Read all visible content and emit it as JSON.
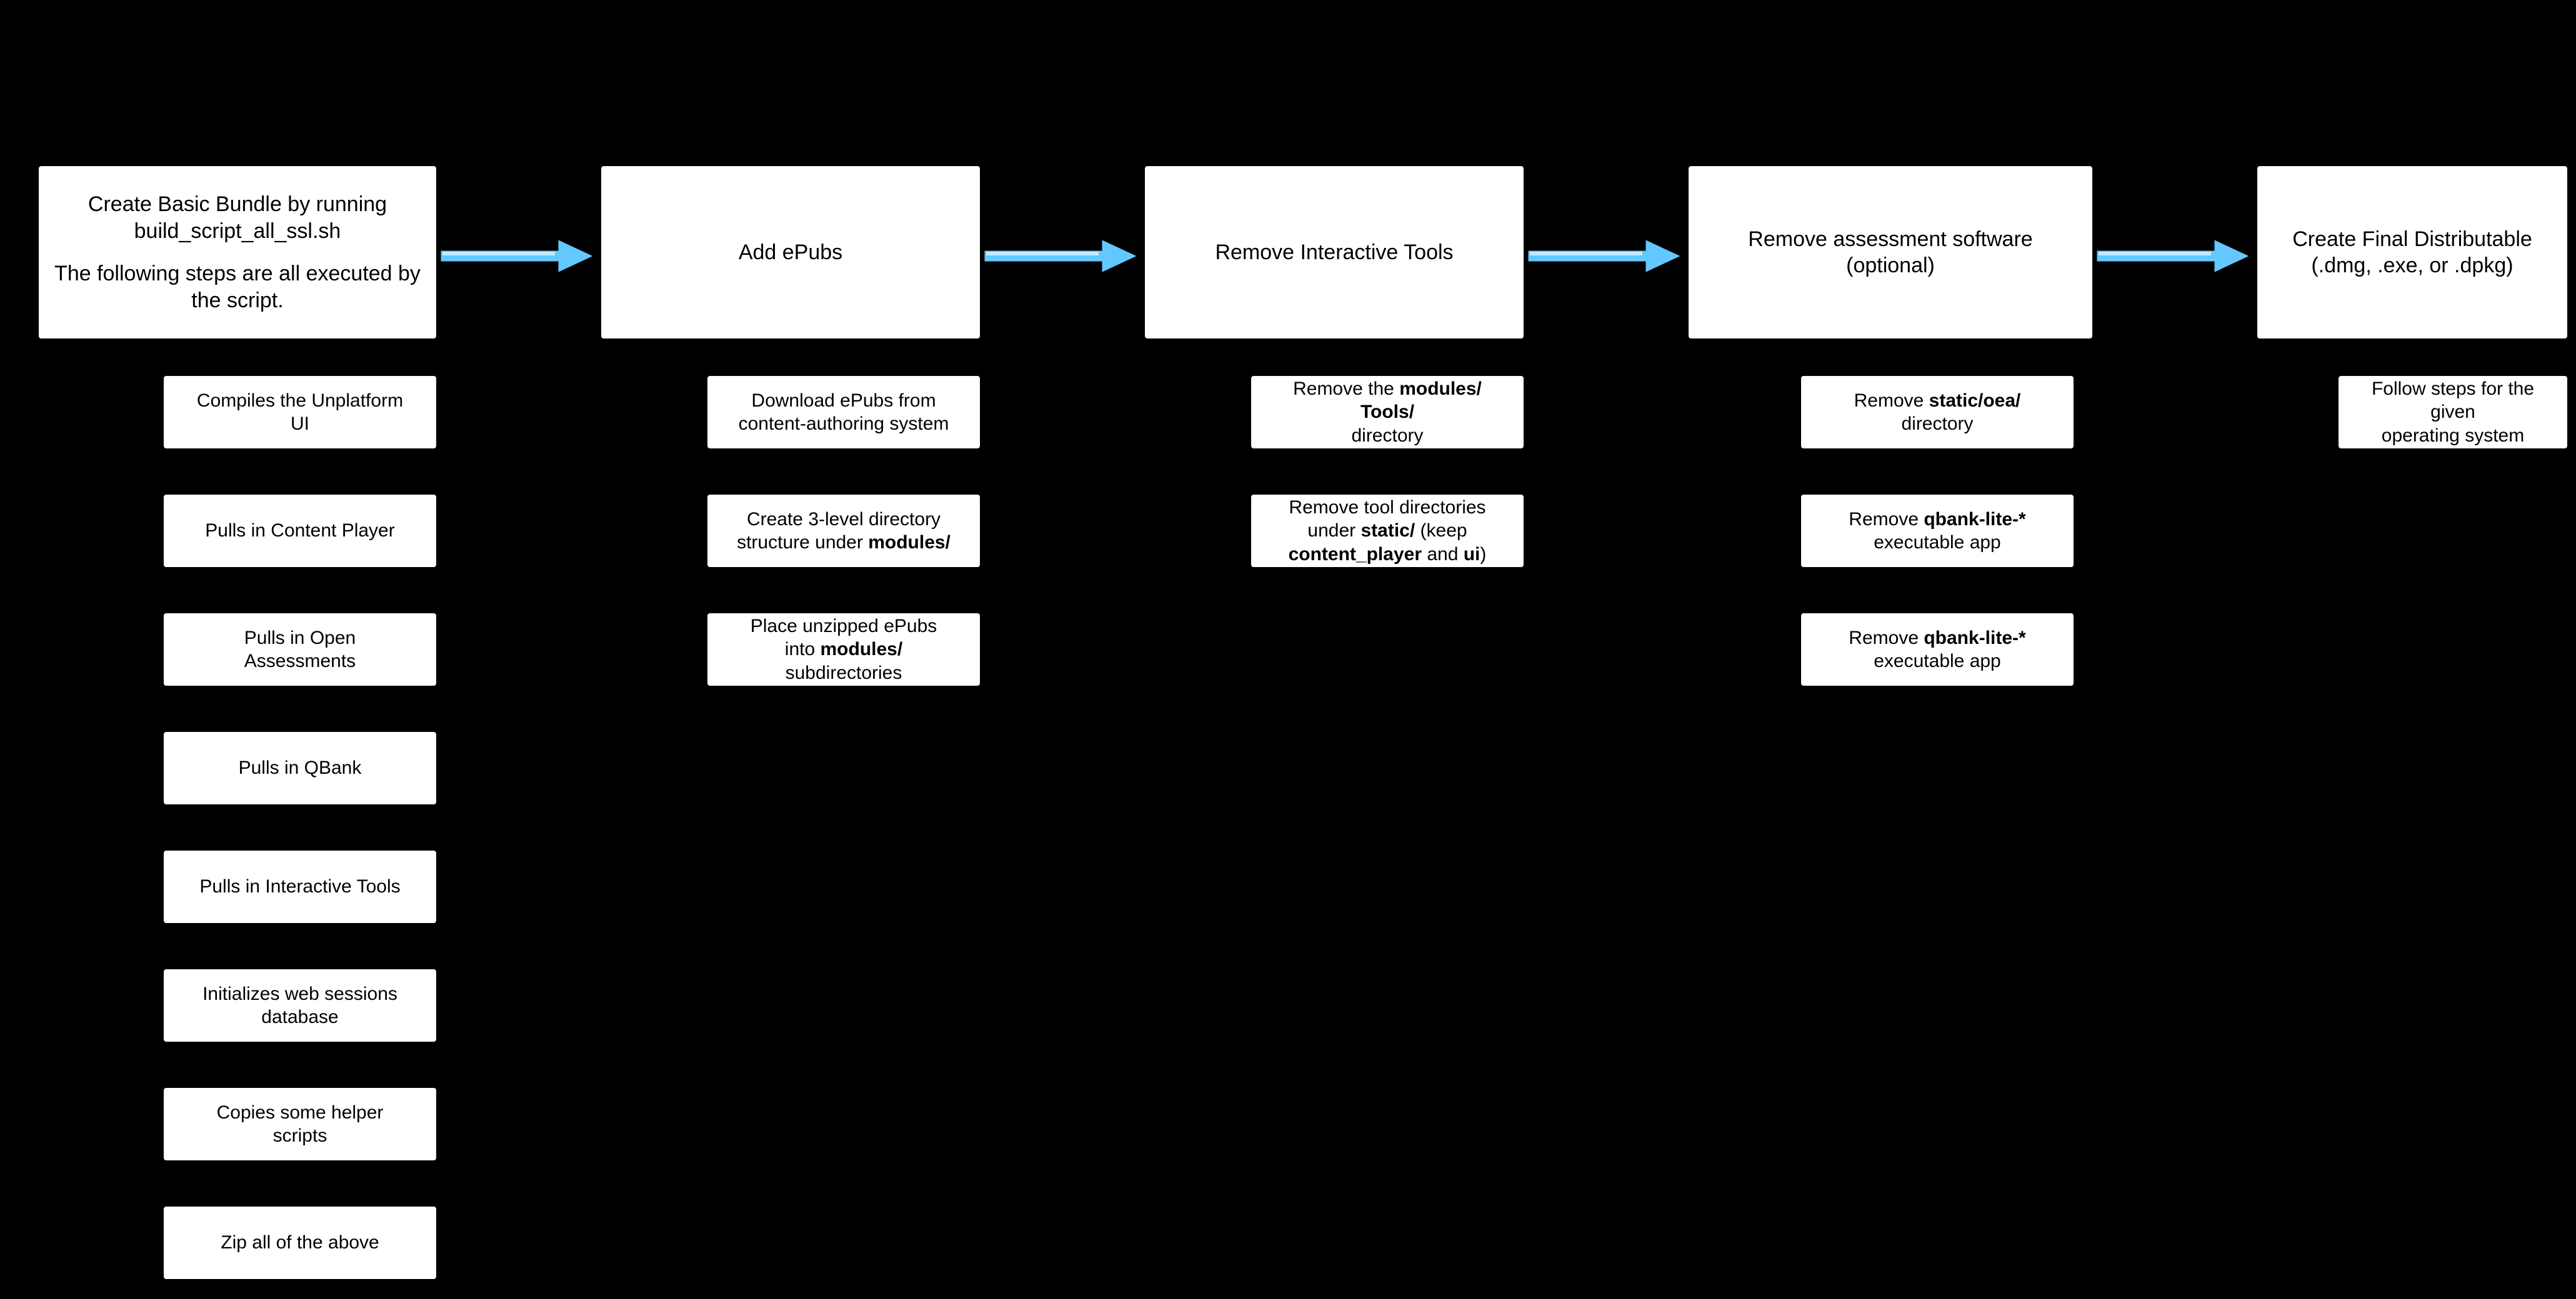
{
  "steps": [
    {
      "id": "create-basic-bundle",
      "lines": [
        "Create Basic Bundle by running",
        "build_script_all_ssl.sh",
        "",
        "The following steps are all executed by",
        "the script."
      ],
      "subs": [
        {
          "id": "compiles-unplatform",
          "text": "Compiles the Unplatform\nUI"
        },
        {
          "id": "pulls-content-player",
          "text": "Pulls in Content Player"
        },
        {
          "id": "pulls-open-assessments",
          "text": "Pulls in Open\nAssessments"
        },
        {
          "id": "pulls-qbank",
          "text": "Pulls in QBank"
        },
        {
          "id": "pulls-interactive-tools",
          "text": "Pulls in Interactive Tools"
        },
        {
          "id": "init-web-sessions",
          "text": "Initializes web sessions\ndatabase"
        },
        {
          "id": "copies-helper-scripts",
          "text": "Copies some helper\nscripts"
        },
        {
          "id": "zip-all",
          "text": "Zip all of the above"
        }
      ]
    },
    {
      "id": "add-epubs",
      "lines": [
        "Add ePubs"
      ],
      "subs": [
        {
          "id": "download-epubs",
          "text": "Download ePubs from\ncontent-authoring system"
        },
        {
          "id": "create-3level-dir",
          "text": "Create 3-level directory\nstructure under <b>modules/</b>"
        },
        {
          "id": "place-unzipped-epubs",
          "text": "Place unzipped ePubs\ninto <b>modules/</b>\nsubdirectories"
        }
      ]
    },
    {
      "id": "remove-interactive-tools",
      "lines": [
        "Remove Interactive Tools"
      ],
      "subs": [
        {
          "id": "remove-modules-tools",
          "text": "Remove the <b>modules/\nTools/</b> directory"
        },
        {
          "id": "remove-tool-dirs-static",
          "text": "Remove tool directories\nunder <b>static/</b> (keep\n<b>content_player</b> and <b>ui</b>)"
        }
      ]
    },
    {
      "id": "remove-assessment-software",
      "lines": [
        "Remove assessment software",
        "(optional)"
      ],
      "subs": [
        {
          "id": "remove-static-oea",
          "text": "Remove <b>static/oea/</b>\ndirectory"
        },
        {
          "id": "remove-qbank-lite-1",
          "text": "Remove <b>qbank-lite-*</b>\nexecutable app"
        },
        {
          "id": "remove-qbank-lite-2",
          "text": "Remove <b>qbank-lite-*</b>\nexecutable app"
        }
      ]
    },
    {
      "id": "create-final-distributable",
      "lines": [
        "Create Final Distributable",
        "(.dmg, .exe, or .dpkg)"
      ],
      "subs": [
        {
          "id": "follow-os-steps",
          "text": "Follow steps for the given\noperating system"
        }
      ]
    }
  ],
  "chart_data": {
    "type": "flowchart",
    "direction": "left-to-right",
    "nodes": [
      {
        "id": "create-basic-bundle",
        "label": "Create Basic Bundle by running build_script_all_ssl.sh — The following steps are all executed by the script."
      },
      {
        "id": "add-epubs",
        "label": "Add ePubs"
      },
      {
        "id": "remove-interactive-tools",
        "label": "Remove Interactive Tools"
      },
      {
        "id": "remove-assessment-software",
        "label": "Remove assessment software (optional)"
      },
      {
        "id": "create-final-distributable",
        "label": "Create Final Distributable (.dmg, .exe, or .dpkg)"
      }
    ],
    "edges": [
      {
        "from": "create-basic-bundle",
        "to": "add-epubs"
      },
      {
        "from": "add-epubs",
        "to": "remove-interactive-tools"
      },
      {
        "from": "remove-interactive-tools",
        "to": "remove-assessment-software"
      },
      {
        "from": "remove-assessment-software",
        "to": "create-final-distributable"
      }
    ],
    "substeps": {
      "create-basic-bundle": [
        "Compiles the Unplatform UI",
        "Pulls in Content Player",
        "Pulls in Open Assessments",
        "Pulls in QBank",
        "Pulls in Interactive Tools",
        "Initializes web sessions database",
        "Copies some helper scripts",
        "Zip all of the above"
      ],
      "add-epubs": [
        "Download ePubs from content-authoring system",
        "Create 3-level directory structure under modules/",
        "Place unzipped ePubs into modules/ subdirectories"
      ],
      "remove-interactive-tools": [
        "Remove the modules/Tools/ directory",
        "Remove tool directories under static/ (keep content_player and ui)"
      ],
      "remove-assessment-software": [
        "Remove static/oea/ directory",
        "Remove qbank-lite-* executable app",
        "Remove qbank-lite-* executable app"
      ],
      "create-final-distributable": [
        "Follow steps for the given operating system"
      ]
    }
  },
  "layout": {
    "mainY": 264,
    "mainH": 280,
    "subStartY": 600,
    "subH": 120,
    "subGap": 70,
    "cols": [
      {
        "mainX": 60,
        "mainW": 640,
        "subX": 260,
        "subW": 440
      },
      {
        "mainX": 960,
        "mainW": 610,
        "subX": 1130,
        "subW": 440
      },
      {
        "mainX": 1830,
        "mainW": 610,
        "subX": 2000,
        "subW": 440
      },
      {
        "mainX": 2700,
        "mainW": 650,
        "subX": 2880,
        "subW": 440
      },
      {
        "mainX": 3610,
        "mainW": 500,
        "subX": 3740,
        "subW": 370
      }
    ],
    "arrowY": 410
  }
}
